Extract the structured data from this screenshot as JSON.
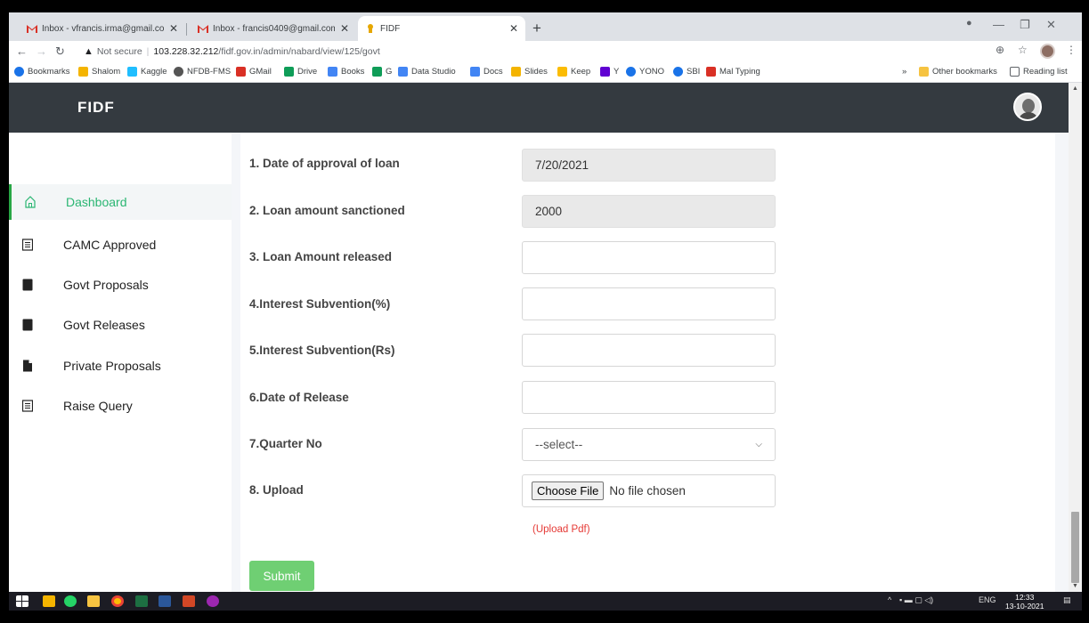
{
  "browser": {
    "tabs": [
      {
        "title": "Inbox - vfrancis.irma@gmail.com",
        "icon": "gmail-icon"
      },
      {
        "title": "Inbox - francis0409@gmail.com",
        "icon": "gmail-icon"
      },
      {
        "title": "FIDF",
        "icon": "fidf-icon"
      }
    ],
    "new_tab": "+",
    "security_label": "Not secure",
    "url_host": "103.228.32.212",
    "url_path": "/fidf.gov.in/admin/nabard/view/125/govt",
    "bookmarks": [
      {
        "label": "Bookmarks",
        "color": "#1a73e8"
      },
      {
        "label": "Shalom",
        "color": "#f4b400"
      },
      {
        "label": "Kaggle",
        "color": "#20beff"
      },
      {
        "label": "NFDB-FMS",
        "color": "#555555"
      },
      {
        "label": "GMail",
        "color": "#d93025"
      },
      {
        "label": "Drive",
        "color": "#0f9d58"
      },
      {
        "label": "Books",
        "color": "#4285f4"
      },
      {
        "label": "G",
        "color": "#0f9d58"
      },
      {
        "label": "Data Studio",
        "color": "#4285f4"
      },
      {
        "label": "Docs",
        "color": "#4285f4"
      },
      {
        "label": "Slides",
        "color": "#f4b400"
      },
      {
        "label": "Keep",
        "color": "#fbbc04"
      },
      {
        "label": "Y",
        "color": "#6001d2"
      },
      {
        "label": "YONO",
        "color": "#1a73e8"
      },
      {
        "label": "SBI",
        "color": "#1a73e8"
      },
      {
        "label": "Mal Typing",
        "color": "#d93025"
      }
    ],
    "bookmarks_overflow": "»",
    "other_bookmarks": "Other bookmarks",
    "reading_list": "Reading list"
  },
  "app": {
    "brand": "FIDF",
    "accent_color": "#28a745",
    "header_color": "#343a40"
  },
  "sidebar": {
    "items": [
      {
        "label": "Dashboard",
        "icon": "home-icon",
        "active": true
      },
      {
        "label": "CAMC Approved",
        "icon": "list-icon",
        "active": false
      },
      {
        "label": "Govt Proposals",
        "icon": "book-icon",
        "active": false
      },
      {
        "label": "Govt Releases",
        "icon": "book-icon",
        "active": false
      },
      {
        "label": "Private Proposals",
        "icon": "file-icon",
        "active": false
      },
      {
        "label": "Raise Query",
        "icon": "list-icon",
        "active": false
      }
    ]
  },
  "form": {
    "fields": [
      {
        "label": "1. Date of approval of loan",
        "value": "7/20/2021",
        "readonly": true
      },
      {
        "label": "2. Loan amount sanctioned",
        "value": "2000",
        "readonly": true
      },
      {
        "label": "3. Loan Amount released",
        "value": "",
        "readonly": false
      },
      {
        "label": "4.Interest Subvention(%)",
        "value": "",
        "readonly": false
      },
      {
        "label": "5.Interest Subvention(Rs)",
        "value": "",
        "readonly": false
      },
      {
        "label": "6.Date of Release",
        "value": "",
        "readonly": false
      }
    ],
    "quarter": {
      "label": "7.Quarter No",
      "selected": "--select--"
    },
    "upload": {
      "label": "8. Upload",
      "button": "Choose File",
      "status": "No file chosen",
      "hint": "(Upload Pdf)"
    },
    "submit_label": "Submit"
  },
  "taskbar": {
    "language": "ENG",
    "time": "12:33",
    "date": "13-10-2021"
  }
}
